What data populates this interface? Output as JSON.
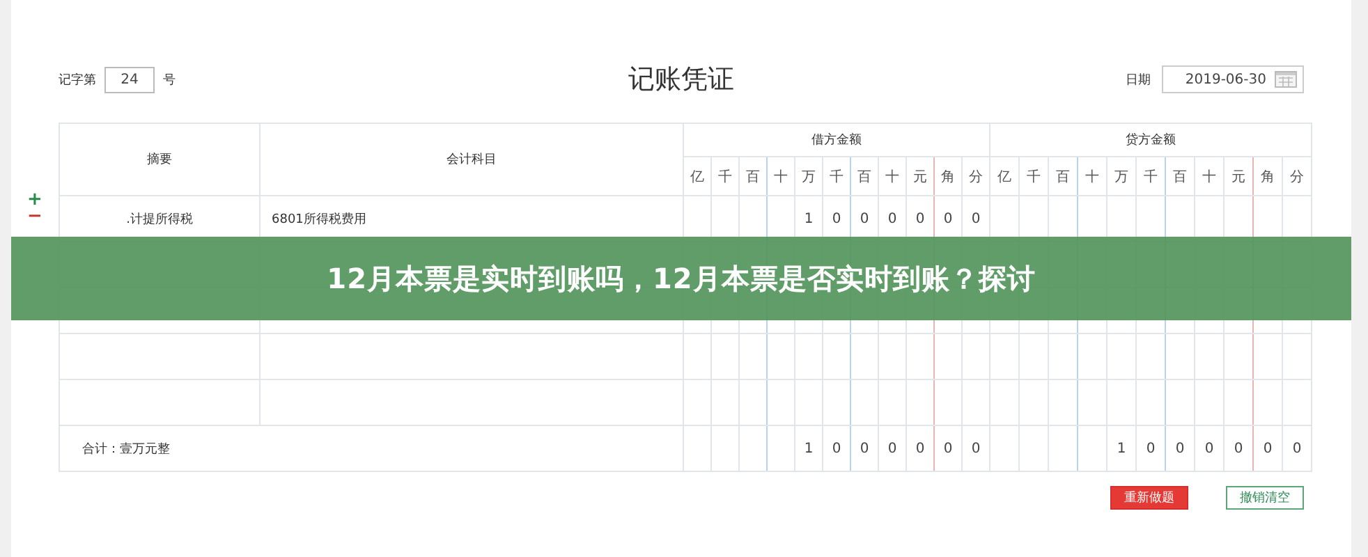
{
  "voucher": {
    "number_label": "记字第",
    "number": "24",
    "number_suffix": "号",
    "title": "记账凭证",
    "date_label": "日期",
    "date": "2019-06-30"
  },
  "table": {
    "columns": [
      "摘要",
      "会计科目"
    ],
    "debit_heading": "借方金额",
    "credit_heading": "贷方金额",
    "debit_units": [
      "亿",
      "千",
      "百",
      "十",
      "万",
      "千",
      "百",
      "十",
      "元",
      "角",
      "分"
    ],
    "credit_units": [
      "亿",
      "千",
      "百",
      "十",
      "万",
      "千",
      "百",
      "十",
      "元",
      "角",
      "分"
    ],
    "rows": [
      {
        "summary": ".计提所得税",
        "account": "6801所得税费用",
        "debit": [
          "1",
          "0",
          "0",
          "0",
          "0",
          "0",
          "0"
        ]
      }
    ],
    "total": {
      "label": "合计：壹万元整",
      "debit": [
        "1",
        "0",
        "0",
        "0",
        "0",
        "0",
        "0"
      ],
      "credit": [
        "1",
        "0",
        "0",
        "0",
        "0",
        "0",
        "0"
      ]
    }
  },
  "row_controls": [
    "+",
    "−"
  ],
  "buttons": [
    {
      "label": "重新做题",
      "kind": "danger"
    },
    {
      "label": "撤销清空",
      "kind": "outline"
    }
  ],
  "banner": {
    "text": "12月本票是实时到账吗，12月本票是否实时到账？探讨"
  }
}
